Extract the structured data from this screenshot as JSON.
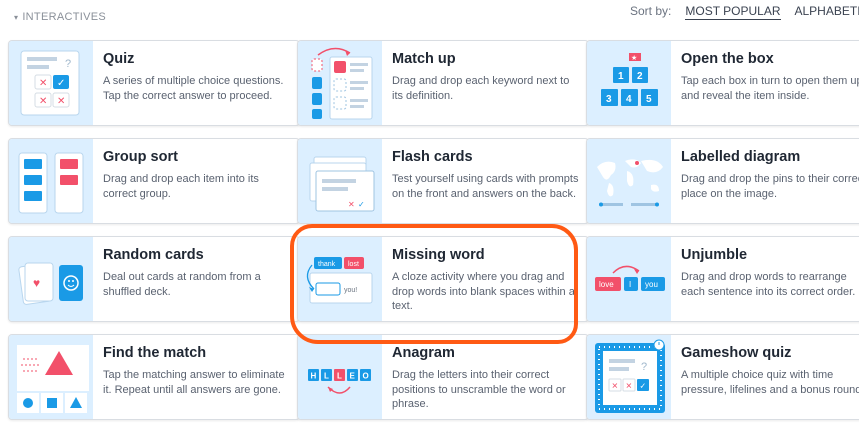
{
  "section": {
    "caret": "▾",
    "label": "INTERACTIVES"
  },
  "sort": {
    "label": "Sort by:",
    "options": [
      "MOST POPULAR",
      "ALPHABETICAL"
    ],
    "active": "MOST POPULAR"
  },
  "cards": [
    {
      "title": "Quiz",
      "desc": "A series of multiple choice questions. Tap the correct answer to proceed."
    },
    {
      "title": "Match up",
      "desc": "Drag and drop each keyword next to its definition."
    },
    {
      "title": "Open the box",
      "desc": "Tap each box in turn to open them up and reveal the item inside."
    },
    {
      "title": "Group sort",
      "desc": "Drag and drop each item into its correct group."
    },
    {
      "title": "Flash cards",
      "desc": "Test yourself using cards with prompts on the front and answers on the back."
    },
    {
      "title": "Labelled diagram",
      "desc": "Drag and drop the pins to their correct place on the image."
    },
    {
      "title": "Random cards",
      "desc": "Deal out cards at random from a shuffled deck."
    },
    {
      "title": "Missing word",
      "desc": "A cloze activity where you drag and drop words into blank spaces within a text."
    },
    {
      "title": "Unjumble",
      "desc": "Drag and drop words to rearrange each sentence into its correct order."
    },
    {
      "title": "Find the match",
      "desc": "Tap the matching answer to eliminate it. Repeat until all answers are gone."
    },
    {
      "title": "Anagram",
      "desc": "Drag the letters into their correct positions to unscramble the word or phrase."
    },
    {
      "title": "Gameshow quiz",
      "desc": "A multiple choice quiz with time pressure, lifelines and a bonus round."
    }
  ],
  "thumb_text": {
    "open_box_numbers": [
      "1",
      "2",
      "3",
      "4",
      "5"
    ],
    "missing_word_words": [
      "thank",
      "lost",
      "you!"
    ],
    "unjumble_words": [
      "love",
      "I",
      "you"
    ],
    "anagram_letters": [
      "H",
      "L",
      "L",
      "E",
      "O"
    ],
    "gameshow_marks": [
      "✕",
      "✕",
      "✓"
    ]
  },
  "colors": {
    "thumb_bg": "#dcefff",
    "blue": "#1a9ae6",
    "red": "#f2506a",
    "highlight": "#ff5a14"
  }
}
